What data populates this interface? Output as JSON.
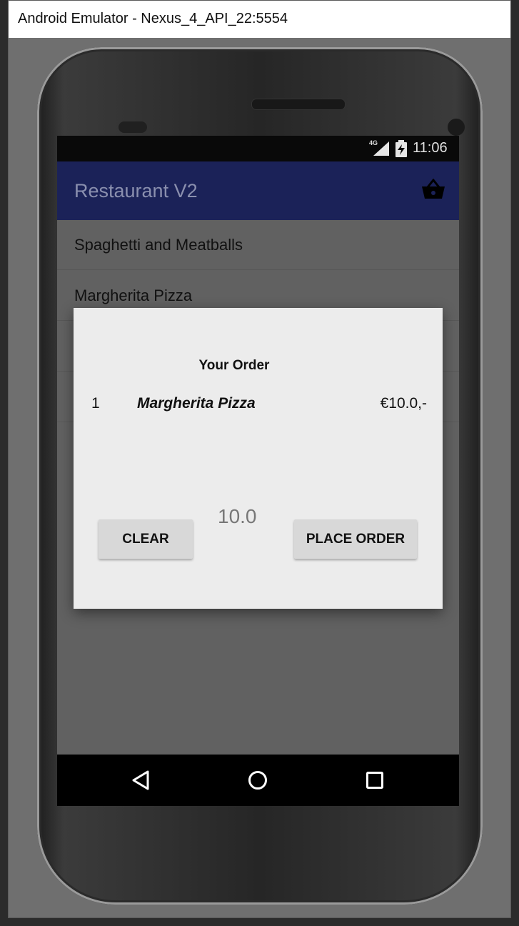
{
  "emulator": {
    "window_title": "Android Emulator - Nexus_4_API_22:5554"
  },
  "status_bar": {
    "network": "4G",
    "time": "11:06"
  },
  "app_bar": {
    "title": "Restaurant V2",
    "cart_icon": "basket-icon"
  },
  "menu_list": {
    "items": [
      {
        "label": "Spaghetti and Meatballs"
      },
      {
        "label": "Margherita Pizza"
      }
    ]
  },
  "order_dialog": {
    "title": "Your Order",
    "items": [
      {
        "quantity": "1",
        "name": "Margherita Pizza",
        "price": "€10.0,-"
      }
    ],
    "total": "10.0",
    "clear_label": "Clear",
    "place_order_label": "Place order"
  },
  "nav_bar": {
    "icons": [
      "back-icon",
      "home-icon",
      "recent-apps-icon"
    ]
  },
  "colors": {
    "app_bar": "#1b2258",
    "dialog_bg": "#ececec",
    "button_bg": "#d8d8d8"
  }
}
